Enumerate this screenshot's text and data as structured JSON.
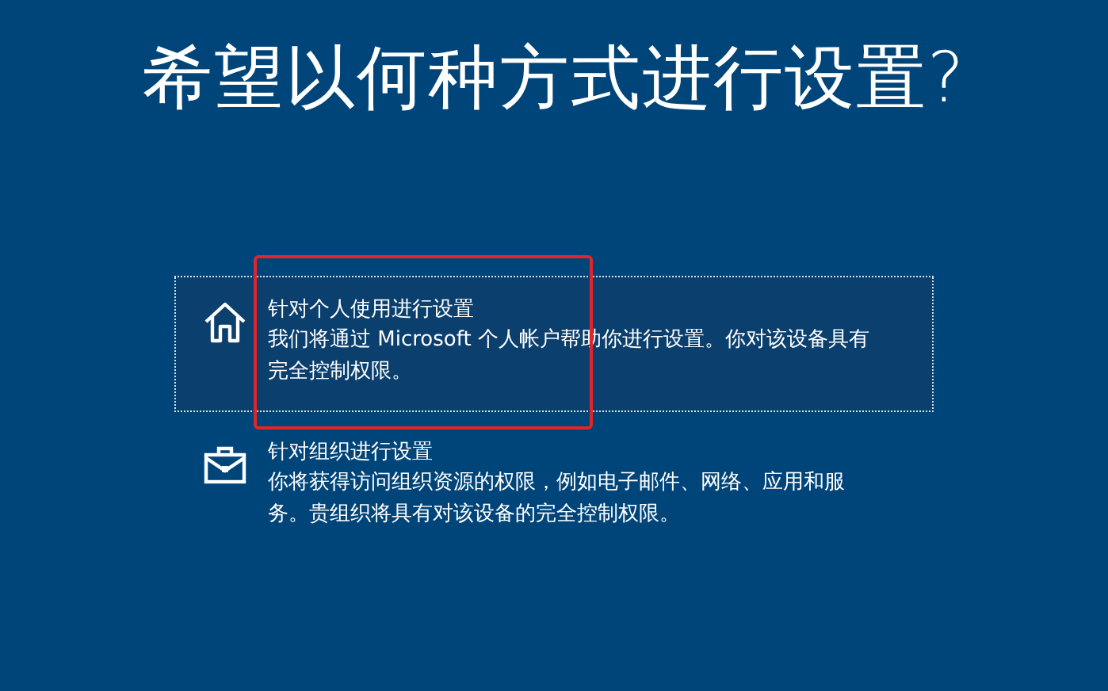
{
  "title": "希望以何种方式进行设置?",
  "options": [
    {
      "kind": "home",
      "title": "针对个人使用进行设置",
      "description": "我们将通过 Microsoft 个人帐户帮助你进行设置。你对该设备具有完全控制权限。",
      "selected": true,
      "highlighted": true
    },
    {
      "kind": "work",
      "title": "针对组织进行设置",
      "description": "你将获得访问组织资源的权限，例如电子邮件、网络、应用和服务。贵组织将具有对该设备的完全控制权限。",
      "selected": false,
      "highlighted": false
    }
  ]
}
